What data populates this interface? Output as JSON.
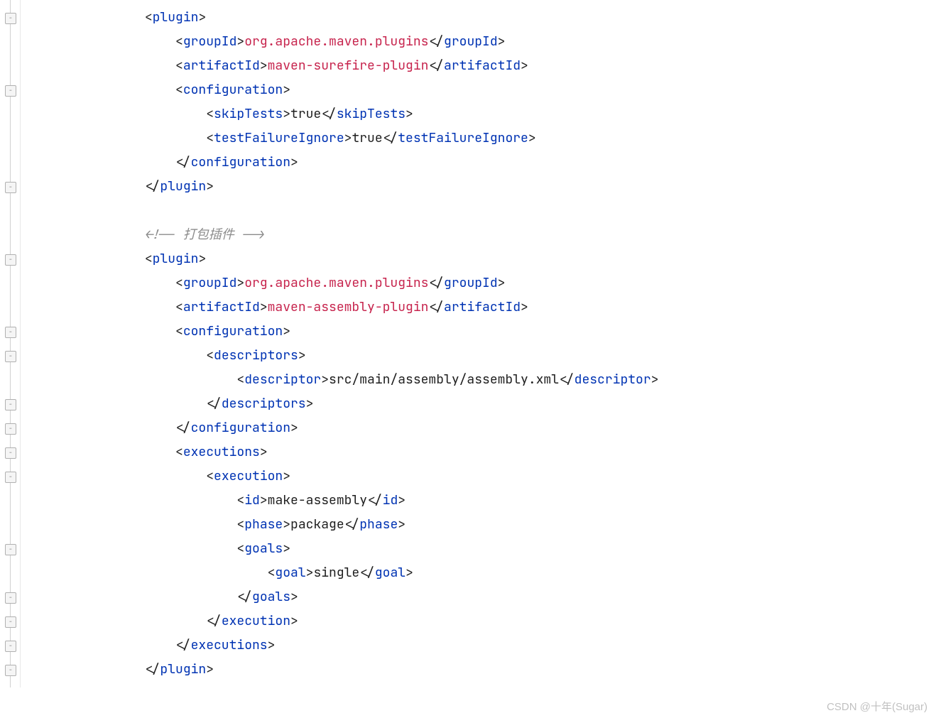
{
  "watermark": "CSDN @十年(Sugar)",
  "lines": [
    {
      "indent": 4,
      "tokens": [
        {
          "t": "punct",
          "v": "<"
        },
        {
          "t": "tag",
          "v": "plugin"
        },
        {
          "t": "punct",
          "v": ">"
        }
      ]
    },
    {
      "indent": 5,
      "tokens": [
        {
          "t": "punct",
          "v": "<"
        },
        {
          "t": "tag",
          "v": "groupId"
        },
        {
          "t": "punct",
          "v": ">"
        },
        {
          "t": "val",
          "v": "org.apache.maven.plugins"
        },
        {
          "t": "punct",
          "v": "</"
        },
        {
          "t": "tag",
          "v": "groupId"
        },
        {
          "t": "punct",
          "v": ">"
        }
      ]
    },
    {
      "indent": 5,
      "tokens": [
        {
          "t": "punct",
          "v": "<"
        },
        {
          "t": "tag",
          "v": "artifactId"
        },
        {
          "t": "punct",
          "v": ">"
        },
        {
          "t": "val",
          "v": "maven-surefire-plugin"
        },
        {
          "t": "punct",
          "v": "</"
        },
        {
          "t": "tag",
          "v": "artifactId"
        },
        {
          "t": "punct",
          "v": ">"
        }
      ]
    },
    {
      "indent": 5,
      "tokens": [
        {
          "t": "punct",
          "v": "<"
        },
        {
          "t": "tag",
          "v": "configuration"
        },
        {
          "t": "punct",
          "v": ">"
        }
      ]
    },
    {
      "indent": 6,
      "tokens": [
        {
          "t": "punct",
          "v": "<"
        },
        {
          "t": "tag",
          "v": "skipTests"
        },
        {
          "t": "punct",
          "v": ">"
        },
        {
          "t": "text",
          "v": "true"
        },
        {
          "t": "punct",
          "v": "</"
        },
        {
          "t": "tag",
          "v": "skipTests"
        },
        {
          "t": "punct",
          "v": ">"
        }
      ]
    },
    {
      "indent": 6,
      "tokens": [
        {
          "t": "punct",
          "v": "<"
        },
        {
          "t": "tag",
          "v": "testFailureIgnore"
        },
        {
          "t": "punct",
          "v": ">"
        },
        {
          "t": "text",
          "v": "true"
        },
        {
          "t": "punct",
          "v": "</"
        },
        {
          "t": "tag",
          "v": "testFailureIgnore"
        },
        {
          "t": "punct",
          "v": ">"
        }
      ]
    },
    {
      "indent": 5,
      "tokens": [
        {
          "t": "punct",
          "v": "</"
        },
        {
          "t": "tag",
          "v": "configuration"
        },
        {
          "t": "punct",
          "v": ">"
        }
      ]
    },
    {
      "indent": 4,
      "tokens": [
        {
          "t": "punct",
          "v": "</"
        },
        {
          "t": "tag",
          "v": "plugin"
        },
        {
          "t": "punct",
          "v": ">"
        }
      ]
    },
    {
      "indent": 0,
      "tokens": []
    },
    {
      "indent": 4,
      "tokens": [
        {
          "t": "comment",
          "v": "<!-- 打包插件 -->"
        }
      ]
    },
    {
      "indent": 4,
      "tokens": [
        {
          "t": "punct",
          "v": "<"
        },
        {
          "t": "tag",
          "v": "plugin"
        },
        {
          "t": "punct",
          "v": ">"
        }
      ]
    },
    {
      "indent": 5,
      "tokens": [
        {
          "t": "punct",
          "v": "<"
        },
        {
          "t": "tag",
          "v": "groupId"
        },
        {
          "t": "punct",
          "v": ">"
        },
        {
          "t": "val",
          "v": "org.apache.maven.plugins"
        },
        {
          "t": "punct",
          "v": "</"
        },
        {
          "t": "tag",
          "v": "groupId"
        },
        {
          "t": "punct",
          "v": ">"
        }
      ]
    },
    {
      "indent": 5,
      "tokens": [
        {
          "t": "punct",
          "v": "<"
        },
        {
          "t": "tag",
          "v": "artifactId"
        },
        {
          "t": "punct",
          "v": ">"
        },
        {
          "t": "val",
          "v": "maven-assembly-plugin"
        },
        {
          "t": "punct",
          "v": "</"
        },
        {
          "t": "tag",
          "v": "artifactId"
        },
        {
          "t": "punct",
          "v": ">"
        }
      ]
    },
    {
      "indent": 5,
      "tokens": [
        {
          "t": "punct",
          "v": "<"
        },
        {
          "t": "tag",
          "v": "configuration"
        },
        {
          "t": "punct",
          "v": ">"
        }
      ]
    },
    {
      "indent": 6,
      "tokens": [
        {
          "t": "punct",
          "v": "<"
        },
        {
          "t": "tag",
          "v": "descriptors"
        },
        {
          "t": "punct",
          "v": ">"
        }
      ]
    },
    {
      "indent": 7,
      "tokens": [
        {
          "t": "punct",
          "v": "<"
        },
        {
          "t": "tag",
          "v": "descriptor"
        },
        {
          "t": "punct",
          "v": ">"
        },
        {
          "t": "text",
          "v": "src/main/assembly/assembly.xml"
        },
        {
          "t": "punct",
          "v": "</"
        },
        {
          "t": "tag",
          "v": "descriptor"
        },
        {
          "t": "punct",
          "v": ">"
        }
      ]
    },
    {
      "indent": 6,
      "tokens": [
        {
          "t": "punct",
          "v": "</"
        },
        {
          "t": "tag",
          "v": "descriptors"
        },
        {
          "t": "punct",
          "v": ">"
        }
      ]
    },
    {
      "indent": 5,
      "tokens": [
        {
          "t": "punct",
          "v": "</"
        },
        {
          "t": "tag",
          "v": "configuration"
        },
        {
          "t": "punct",
          "v": ">"
        }
      ]
    },
    {
      "indent": 5,
      "tokens": [
        {
          "t": "punct",
          "v": "<"
        },
        {
          "t": "tag",
          "v": "executions"
        },
        {
          "t": "punct",
          "v": ">"
        }
      ]
    },
    {
      "indent": 6,
      "tokens": [
        {
          "t": "punct",
          "v": "<"
        },
        {
          "t": "tag",
          "v": "execution"
        },
        {
          "t": "punct",
          "v": ">"
        }
      ]
    },
    {
      "indent": 7,
      "tokens": [
        {
          "t": "punct",
          "v": "<"
        },
        {
          "t": "tag",
          "v": "id"
        },
        {
          "t": "punct",
          "v": ">"
        },
        {
          "t": "text",
          "v": "make-assembly"
        },
        {
          "t": "punct",
          "v": "</"
        },
        {
          "t": "tag",
          "v": "id"
        },
        {
          "t": "punct",
          "v": ">"
        }
      ]
    },
    {
      "indent": 7,
      "tokens": [
        {
          "t": "punct",
          "v": "<"
        },
        {
          "t": "tag",
          "v": "phase"
        },
        {
          "t": "punct",
          "v": ">"
        },
        {
          "t": "text",
          "v": "package"
        },
        {
          "t": "punct",
          "v": "</"
        },
        {
          "t": "tag",
          "v": "phase"
        },
        {
          "t": "punct",
          "v": ">"
        }
      ]
    },
    {
      "indent": 7,
      "tokens": [
        {
          "t": "punct",
          "v": "<"
        },
        {
          "t": "tag",
          "v": "goals"
        },
        {
          "t": "punct",
          "v": ">"
        }
      ]
    },
    {
      "indent": 8,
      "tokens": [
        {
          "t": "punct",
          "v": "<"
        },
        {
          "t": "tag",
          "v": "goal"
        },
        {
          "t": "punct",
          "v": ">"
        },
        {
          "t": "text",
          "v": "single"
        },
        {
          "t": "punct",
          "v": "</"
        },
        {
          "t": "tag",
          "v": "goal"
        },
        {
          "t": "punct",
          "v": ">"
        }
      ]
    },
    {
      "indent": 7,
      "tokens": [
        {
          "t": "punct",
          "v": "</"
        },
        {
          "t": "tag",
          "v": "goals"
        },
        {
          "t": "punct",
          "v": ">"
        }
      ]
    },
    {
      "indent": 6,
      "tokens": [
        {
          "t": "punct",
          "v": "</"
        },
        {
          "t": "tag",
          "v": "execution"
        },
        {
          "t": "punct",
          "v": ">"
        }
      ]
    },
    {
      "indent": 5,
      "tokens": [
        {
          "t": "punct",
          "v": "</"
        },
        {
          "t": "tag",
          "v": "executions"
        },
        {
          "t": "punct",
          "v": ">"
        }
      ]
    },
    {
      "indent": 4,
      "tokens": [
        {
          "t": "punct",
          "v": "</"
        },
        {
          "t": "tag",
          "v": "plugin"
        },
        {
          "t": "punct",
          "v": ">"
        }
      ]
    }
  ],
  "foldRows": [
    0,
    3,
    7,
    10,
    13,
    14,
    16,
    17,
    18,
    19,
    22,
    24,
    25,
    26,
    27
  ]
}
